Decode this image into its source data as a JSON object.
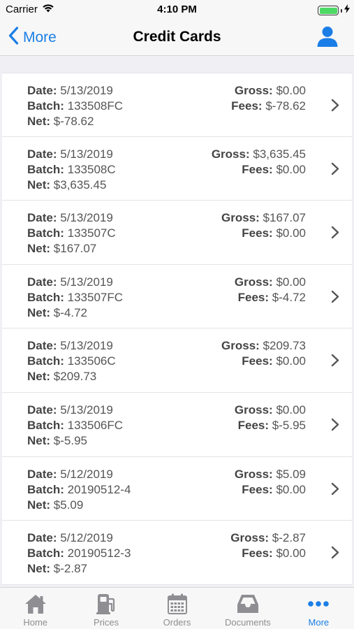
{
  "status": {
    "carrier": "Carrier",
    "time": "4:10 PM"
  },
  "nav": {
    "back_label": "More",
    "title": "Credit Cards"
  },
  "labels": {
    "date": "Date:",
    "batch": "Batch:",
    "net": "Net:",
    "gross": "Gross:",
    "fees": "Fees:"
  },
  "rows": [
    {
      "date": "5/13/2019",
      "batch": "133508FC",
      "net": "$-78.62",
      "gross": "$0.00",
      "fees": "$-78.62"
    },
    {
      "date": "5/13/2019",
      "batch": "133508C",
      "net": "$3,635.45",
      "gross": "$3,635.45",
      "fees": "$0.00"
    },
    {
      "date": "5/13/2019",
      "batch": "133507C",
      "net": "$167.07",
      "gross": "$167.07",
      "fees": "$0.00"
    },
    {
      "date": "5/13/2019",
      "batch": "133507FC",
      "net": "$-4.72",
      "gross": "$0.00",
      "fees": "$-4.72"
    },
    {
      "date": "5/13/2019",
      "batch": "133506C",
      "net": "$209.73",
      "gross": "$209.73",
      "fees": "$0.00"
    },
    {
      "date": "5/13/2019",
      "batch": "133506FC",
      "net": "$-5.95",
      "gross": "$0.00",
      "fees": "$-5.95"
    },
    {
      "date": "5/12/2019",
      "batch": "20190512-4",
      "net": "$5.09",
      "gross": "$5.09",
      "fees": "$0.00"
    },
    {
      "date": "5/12/2019",
      "batch": "20190512-3",
      "net": "$-2.87",
      "gross": "$-2.87",
      "fees": "$0.00"
    }
  ],
  "tabs": [
    {
      "label": "Home",
      "icon": "home-icon"
    },
    {
      "label": "Prices",
      "icon": "fuel-pump-icon"
    },
    {
      "label": "Orders",
      "icon": "calendar-icon"
    },
    {
      "label": "Documents",
      "icon": "inbox-tray-icon"
    },
    {
      "label": "More",
      "icon": "more-dots-icon",
      "active": true
    }
  ],
  "colors": {
    "accent": "#1a7ee6",
    "inactive": "#8e8e93",
    "battery": "#4cd964"
  }
}
